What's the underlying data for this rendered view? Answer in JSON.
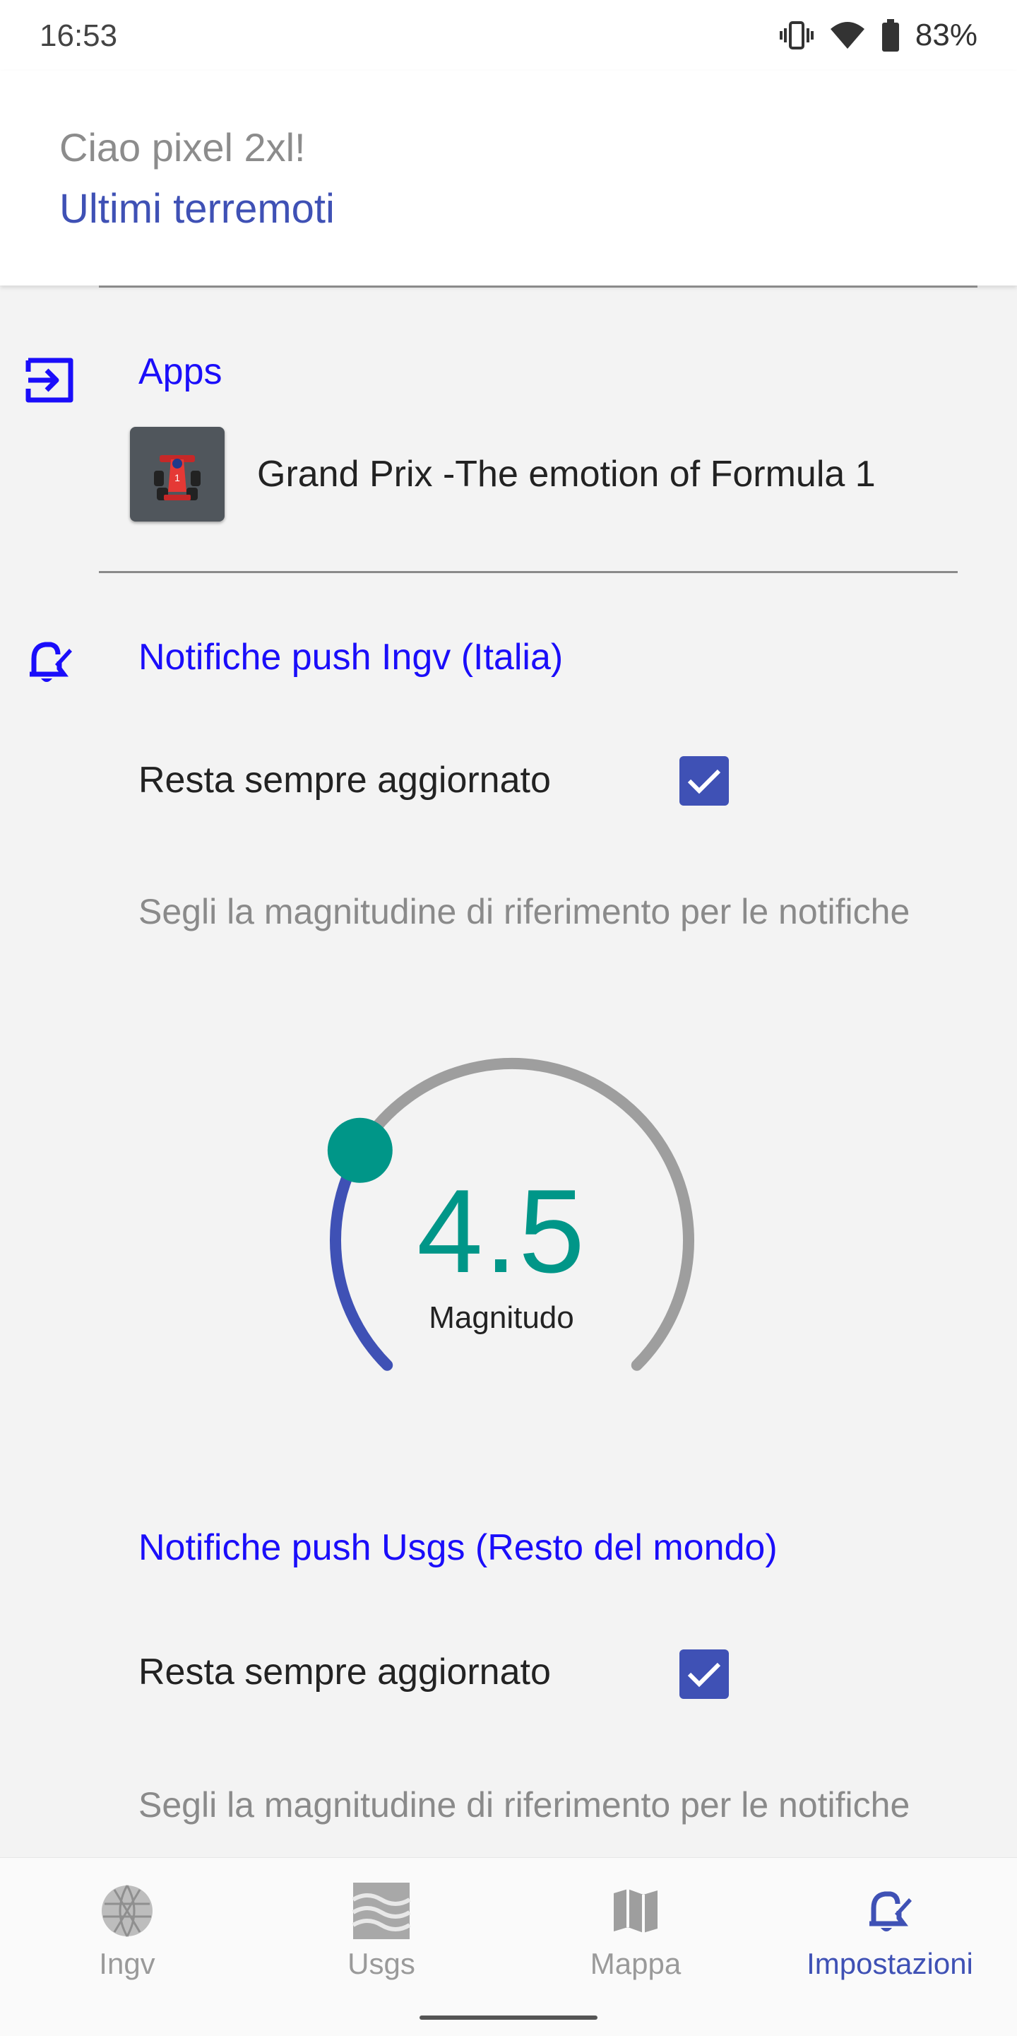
{
  "status_bar": {
    "time": "16:53",
    "battery": "83%"
  },
  "header": {
    "greeting": "Ciao pixel 2xl!",
    "subtitle": "Ultimi terremoti"
  },
  "apps_section": {
    "title": "Apps",
    "items": [
      {
        "name": "Grand Prix -The emotion of Formula 1",
        "icon": "race-car-icon"
      }
    ]
  },
  "ingv_section": {
    "title": "Notifiche push Ingv (Italia)",
    "toggle_label": "Resta sempre aggiornato",
    "toggle_checked": true,
    "hint": "Segli la magnitudine di riferimento per le notifiche",
    "gauge": {
      "value": "4.5",
      "label": "Magnitudo",
      "fraction": 0.28
    }
  },
  "usgs_section": {
    "title": "Notifiche push Usgs (Resto del mondo)",
    "toggle_label": "Resta sempre aggiornato",
    "toggle_checked": true,
    "hint": "Segli la magnitudine di riferimento per le notifiche"
  },
  "bottom_nav": {
    "items": [
      {
        "label": "Ingv",
        "icon": "globe-icon"
      },
      {
        "label": "Usgs",
        "icon": "waves-icon"
      },
      {
        "label": "Mappa",
        "icon": "map-icon"
      },
      {
        "label": "Impostazioni",
        "icon": "settings-bell-icon"
      }
    ],
    "active_index": 3
  },
  "colors": {
    "accent": "#3f51b5",
    "link_blue": "#1a0dfa",
    "teal": "#009688",
    "track": "#9e9e9e"
  }
}
